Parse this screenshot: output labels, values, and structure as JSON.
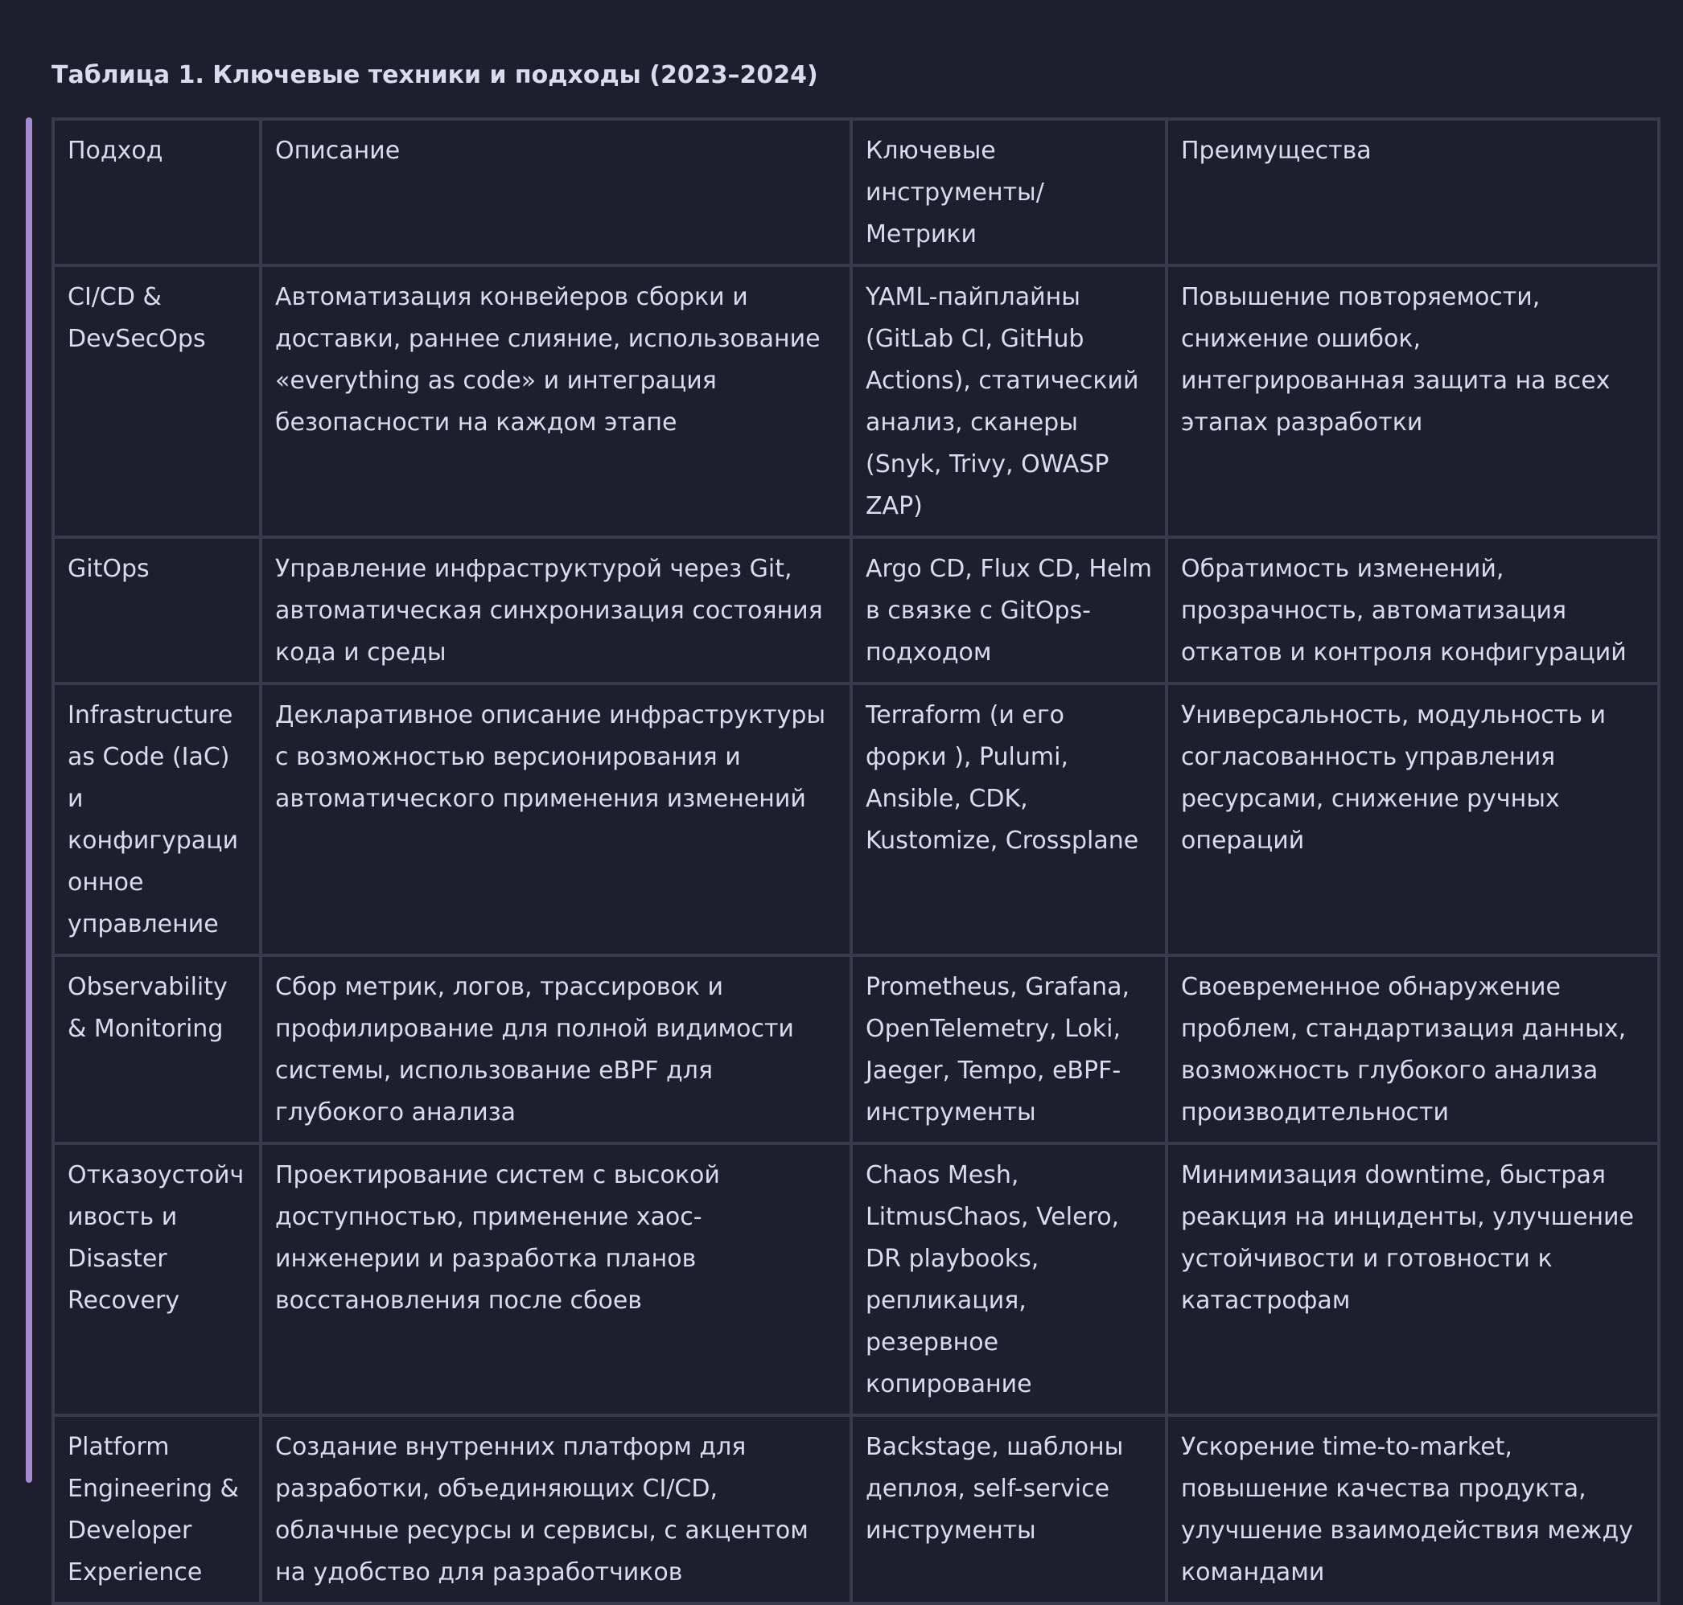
{
  "caption": "Таблица 1. Ключевые техники и подходы (2023–2024)",
  "table": {
    "headers": [
      "Подход",
      "Описание",
      "Ключевые инструменты/Метрики",
      "Преимущества"
    ],
    "rows": [
      [
        "CI/CD & DevSecOps",
        "Автоматизация конвейеров сборки и доставки, раннее слияние, использование «everything as code» и интеграция безопасности на каждом этапе",
        "YAML-пайплайны (GitLab CI, GitHub Actions), статический анализ, сканеры (Snyk, Trivy, OWASP ZAP)",
        "Повышение повторяемости, снижение ошибок, интегрированная защита на всех этапах разработки"
      ],
      [
        "GitOps",
        "Управление инфраструктурой через Git, автоматическая синхронизация состояния кода и среды",
        "Argo CD, Flux CD, Helm в связке с GitOps-подходом",
        "Обратимость изменений, прозрачность, автоматизация откатов и контроля конфигураций"
      ],
      [
        "Infrastructure as Code (IaC) и конфигурационное управление",
        "Декларативное описание инфраструктуры с возможностью версионирования и автоматического применения изменений",
        "Terraform (и его форки ), Pulumi, Ansible, CDK, Kustomize, Crossplane",
        "Универсальность, модульность и согласованность управления ресурсами, снижение ручных операций"
      ],
      [
        "Observability & Monitoring",
        "Сбор метрик, логов, трассировок и профилирование для полной видимости системы, использование eBPF для глубокого анализа",
        "Prometheus, Grafana, OpenTelemetry, Loki, Jaeger, Tempo, eBPF-инструменты",
        "Своевременное обнаружение проблем, стандартизация данных, возможность глубокого анализа производительности"
      ],
      [
        "Отказоустойчивость и Disaster Recovery",
        "Проектирование систем с высокой доступностью, применение хаос-инженерии и разработка планов восстановления после сбоев",
        "Chaos Mesh, LitmusChaos, Velero, DR playbooks, репликация, резервное копирование",
        "Минимизация downtime, быстрая реакция на инциденты, улучшение устойчивости и готовности к катастрофам"
      ],
      [
        "Platform Engineering & Developer Experience",
        "Создание внутренних платформ для разработки, объединяющих CI/CD, облачные ресурсы и сервисы, с акцентом на удобство для разработчиков",
        "Backstage, шаблоны деплоя, self-service инструменты",
        "Ускорение time-to-market, повышение качества продукта, улучшение взаимодействия между командами"
      ]
    ]
  }
}
